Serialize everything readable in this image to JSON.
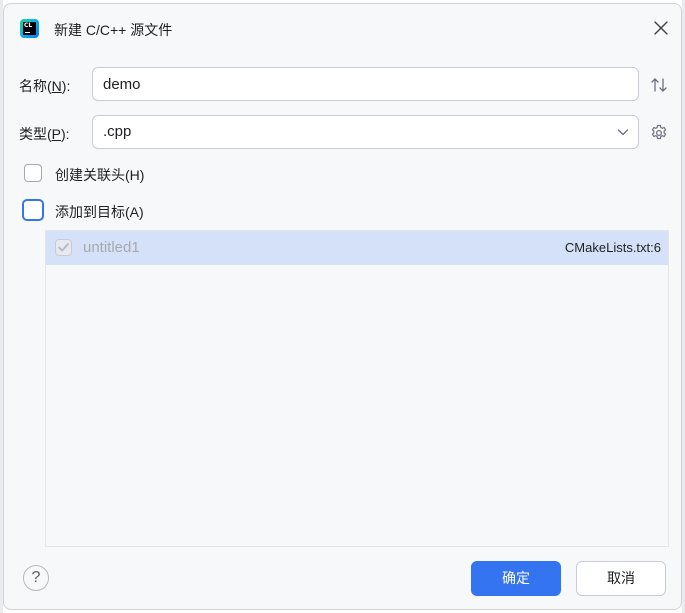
{
  "window": {
    "title": "新建 C/C++ 源文件",
    "app_icon_text": "CL"
  },
  "form": {
    "name_label_prefix": "名称(",
    "name_label_mnemonic": "N",
    "name_label_suffix": "):",
    "name_value": "demo",
    "type_label_prefix": "类型(",
    "type_label_mnemonic": "P",
    "type_label_suffix": "):",
    "type_value": ".cpp"
  },
  "options": {
    "create_header_label": "创建关联头(H)",
    "create_header_checked": false,
    "add_to_target_label": "添加到目标(A)",
    "add_to_target_checked": false
  },
  "targets": [
    {
      "name": "untitled1",
      "location": "CMakeLists.txt:6",
      "checked": true,
      "disabled": true
    }
  ],
  "footer": {
    "help_label": "?",
    "ok_label": "确定",
    "cancel_label": "取消"
  },
  "colors": {
    "accent": "#3574f0",
    "selection": "#d5e1f8",
    "dialog_bg": "#f7f8fa"
  },
  "icons": {
    "sort": "sort-arrows-icon",
    "settings": "gear-icon",
    "close": "close-icon",
    "dropdown": "chevron-down-icon"
  }
}
